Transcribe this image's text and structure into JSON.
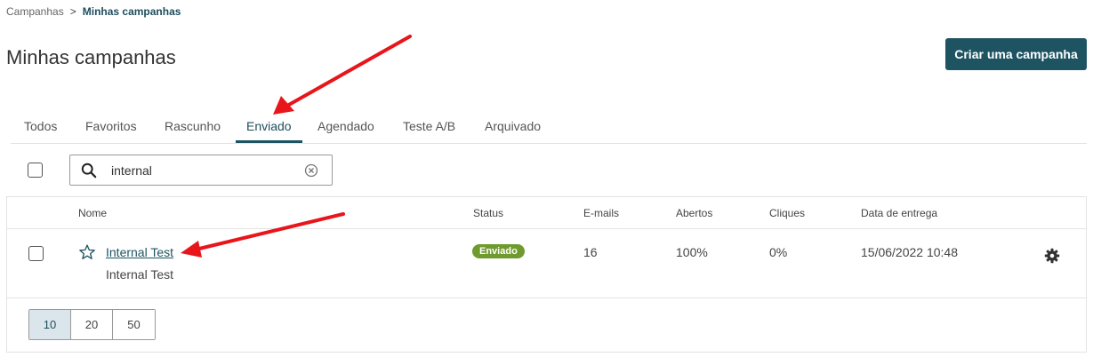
{
  "breadcrumb": {
    "parent": "Campanhas",
    "separator": ">",
    "current": "Minhas campanhas"
  },
  "page": {
    "title": "Minhas campanhas",
    "create_button": "Criar uma campanha"
  },
  "tabs": [
    {
      "label": "Todos"
    },
    {
      "label": "Favoritos"
    },
    {
      "label": "Rascunho"
    },
    {
      "label": "Enviado",
      "active": true
    },
    {
      "label": "Agendado"
    },
    {
      "label": "Teste A/B"
    },
    {
      "label": "Arquivado"
    }
  ],
  "search": {
    "value": "internal",
    "icon": "search-icon",
    "clear_icon": "clear-circle-icon"
  },
  "table": {
    "headers": {
      "name": "Nome",
      "status": "Status",
      "emails": "E-mails",
      "opens": "Abertos",
      "clicks": "Cliques",
      "delivery": "Data de entrega"
    },
    "rows": [
      {
        "name": "Internal Test",
        "subtitle": "Internal Test",
        "status": "Enviado",
        "emails": "16",
        "opens": "100%",
        "clicks": "0%",
        "delivery": "15/06/2022 10:48"
      }
    ]
  },
  "pagination": {
    "sizes": [
      "10",
      "20",
      "50"
    ],
    "selected": "10"
  },
  "colors": {
    "primary": "#1e5462",
    "status_sent": "#6f9a2d",
    "annotation_arrow": "#e8151b"
  }
}
